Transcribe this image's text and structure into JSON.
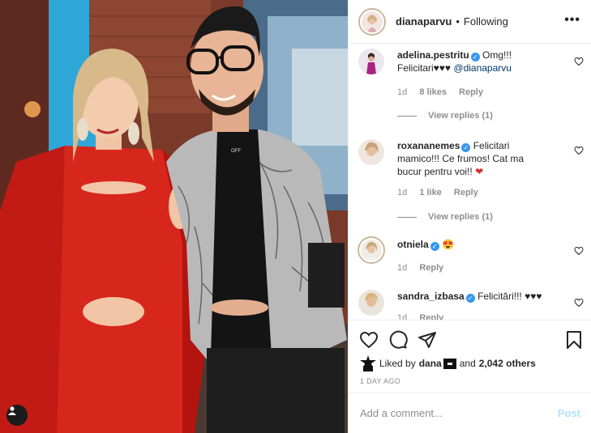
{
  "header": {
    "username": "dianaparvu",
    "separator": "•",
    "follow_status": "Following",
    "more_icon": "more-horizontal-icon"
  },
  "comments": [
    {
      "username": "adelina.pestritu",
      "verified": true,
      "text_line1": "Omg!!!",
      "text_line2": "Felicitari♥♥♥",
      "mention": "@dianaparvu",
      "age": "1d",
      "likes": "8 likes",
      "reply": "Reply",
      "view_replies": "View replies (1)"
    },
    {
      "username": "roxananemes",
      "verified": true,
      "text_line1": "Felicitari",
      "text_line2": "mamico!!! Ce frumos! Cat ma",
      "text_line3": "bucur pentru voi!!",
      "emoji": "❤",
      "age": "1d",
      "likes": "1 like",
      "reply": "Reply",
      "view_replies": "View replies (1)"
    },
    {
      "username": "otniela",
      "verified": true,
      "emoji": "😍",
      "age": "1d",
      "reply": "Reply"
    },
    {
      "username": "sandra_izbasa",
      "verified": true,
      "text_line1": "Felicitări!!! ♥♥♥",
      "age": "1d",
      "reply": "Reply"
    }
  ],
  "actions": {
    "like_icon": "heart-outline-icon",
    "comment_icon": "comment-bubble-icon",
    "share_icon": "paper-plane-icon",
    "save_icon": "bookmark-icon",
    "liked_by_prefix": "Liked by",
    "liked_by_user": "dana",
    "and_text": "and",
    "others_count": "2,042 others",
    "time_ago": "1 DAY AGO"
  },
  "add_comment": {
    "placeholder": "Add a comment...",
    "post_label": "Post"
  },
  "colors": {
    "verified_blue": "#3897f0",
    "post_disabled": "#b2dffc",
    "muted_text": "#8e8e8e",
    "dress_red": "#d7261b"
  }
}
